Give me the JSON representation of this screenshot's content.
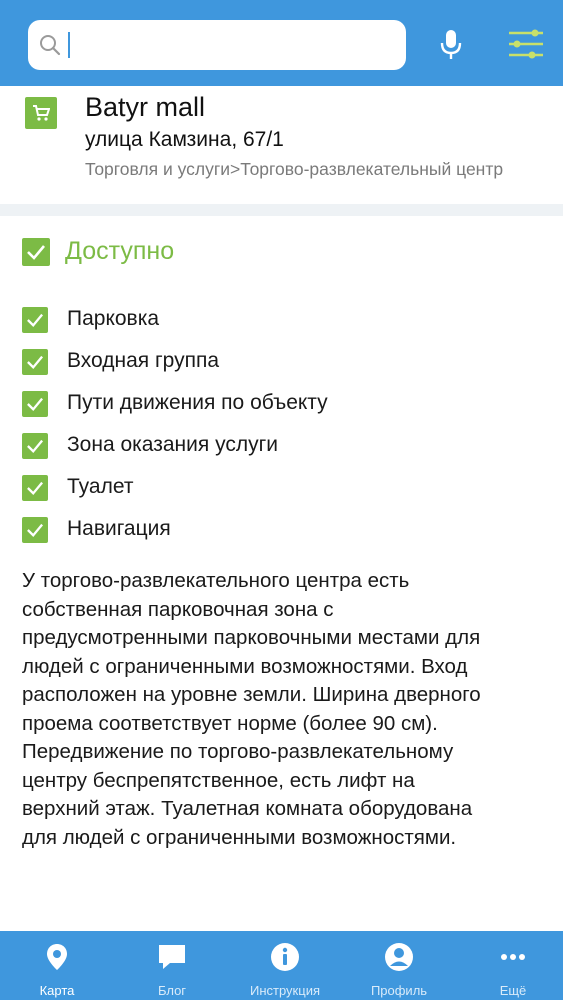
{
  "search": {
    "placeholder": "",
    "value": ""
  },
  "place": {
    "name": "Batyr mall",
    "address": "улица Камзина, 67/1",
    "category": "Торговля и услуги>Торгово-развлекательный центр"
  },
  "availability": {
    "status": "Доступно",
    "features": [
      "Парковка",
      "Входная группа",
      "Пути движения по объекту",
      "Зона оказания услуги",
      "Туалет",
      "Навигация"
    ],
    "description_lines": [
      "У торгово-развлекательного центра есть",
      "собственная парковочная зона с",
      "предусмотренными парковочными местами для",
      "людей с ограниченными возможностями. Вход",
      "расположен на уровне земли. Ширина дверного",
      "проема соответствует норме (более 90 см).",
      "Передвижение по торгово-развлекательному",
      "центру беспрепятственное, есть лифт на",
      "верхний этаж. Туалетная комната оборудована",
      "для людей с ограниченными возможностями."
    ]
  },
  "nav": {
    "items": [
      {
        "label": "Карта",
        "icon": "map-pin-icon",
        "active": true
      },
      {
        "label": "Блог",
        "icon": "chat-bubble-icon",
        "active": false
      },
      {
        "label": "Инструкция",
        "icon": "info-icon",
        "active": false
      },
      {
        "label": "Профиль",
        "icon": "profile-icon",
        "active": false
      },
      {
        "label": "Ещё",
        "icon": "more-icon",
        "active": false
      }
    ]
  },
  "colors": {
    "primary": "#3f97dd",
    "accent_green": "#7cbb45",
    "filter_icon": "#c8e06a"
  }
}
